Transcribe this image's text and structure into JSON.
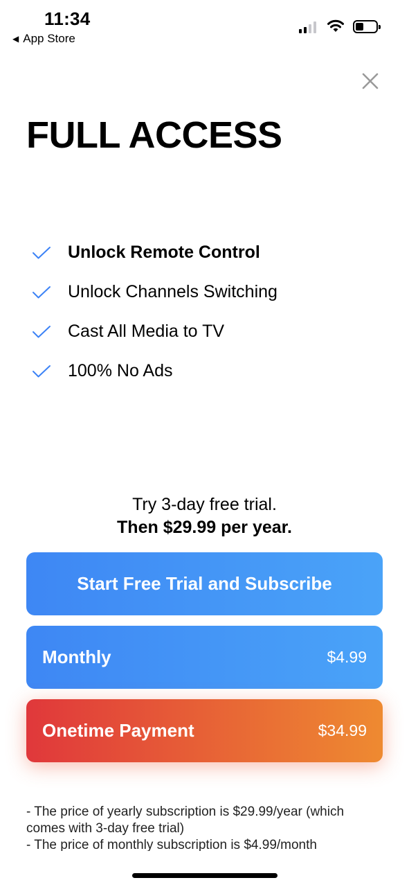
{
  "status_bar": {
    "time": "11:34",
    "back_label": "App Store"
  },
  "title": "FULL ACCESS",
  "features": [
    {
      "label": "Unlock Remote Control",
      "bold": true
    },
    {
      "label": "Unlock Channels Switching",
      "bold": false
    },
    {
      "label": "Cast All Media to TV",
      "bold": false
    },
    {
      "label": "100% No Ads",
      "bold": false
    }
  ],
  "trial": {
    "line1": "Try 3-day free trial.",
    "line2": "Then $29.99 per year."
  },
  "buttons": {
    "start": "Start Free Trial and Subscribe",
    "monthly": {
      "label": "Monthly",
      "price": "$4.99"
    },
    "onetime": {
      "label": "Onetime Payment",
      "price": "$34.99"
    }
  },
  "fine_print": [
    "- The price of yearly subscription is $29.99/year (which comes with 3-day free trial)",
    "- The price of monthly subscription is $4.99/month"
  ],
  "colors": {
    "check": "#3b82f6",
    "blue_start": "#3e87f4",
    "blue_end": "#4aa3f8",
    "red_start": "#e0383b",
    "orange_end": "#ee8a31"
  },
  "icons": {
    "close": "close-icon",
    "check": "checkmark-icon",
    "back": "back-triangle-icon",
    "signal": "cellular-signal-icon",
    "wifi": "wifi-icon",
    "battery": "battery-icon"
  }
}
